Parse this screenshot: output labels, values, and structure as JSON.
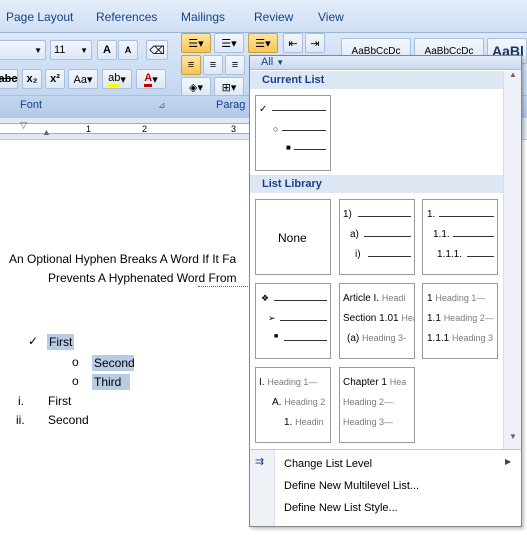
{
  "tabs": {
    "page_layout": "Page Layout",
    "references": "References",
    "mailings": "Mailings",
    "review": "Review",
    "view": "View"
  },
  "ribbon": {
    "font_size": "11",
    "font_group": "Font",
    "para_group": "Parag",
    "style_sample": "AaBbCcDc"
  },
  "ruler": {
    "n1": "1",
    "n2": "2",
    "n3": "3"
  },
  "doc": {
    "line1": "An Optional Hyphen Breaks A Word If It Fa",
    "line2": "Prevents A Hyphenated Word From",
    "watermark": "jaz·.s.com",
    "items": [
      {
        "marker": "✓",
        "text": "First"
      },
      {
        "marker": "o",
        "text": "Second"
      },
      {
        "marker": "o",
        "text": "Third"
      },
      {
        "marker": "i.",
        "text": "First"
      },
      {
        "marker": "ii.",
        "text": "Second"
      }
    ]
  },
  "dropdown": {
    "filter": "All",
    "current_list": "Current List",
    "list_library": "List Library",
    "none": "None",
    "lib2": [
      "1)",
      "a)",
      "i)"
    ],
    "lib3": [
      "1.",
      "1.1.",
      "1.1.1."
    ],
    "lib5_1": [
      "Article I.",
      "Headi"
    ],
    "lib5_2": [
      "Section 1.01",
      "Headi"
    ],
    "lib5_3": [
      "(a)",
      "Heading 3-"
    ],
    "lib6_1": [
      "1",
      "Heading 1—"
    ],
    "lib6_2": [
      "1.1",
      "Heading 2—"
    ],
    "lib6_3": [
      "1.1.1",
      "Heading 3"
    ],
    "lib7_1": [
      "I.",
      "Heading 1—"
    ],
    "lib7_2": [
      "A.",
      "Heading 2"
    ],
    "lib7_3": [
      "1.",
      "Headin"
    ],
    "lib8_1": [
      "Chapter 1",
      "Hea"
    ],
    "lib8_2": [
      "Heading 2—"
    ],
    "lib8_3": [
      "Heading 3—"
    ],
    "menu": [
      "Change List Level",
      "Define New Multilevel List...",
      "Define New List Style..."
    ]
  }
}
